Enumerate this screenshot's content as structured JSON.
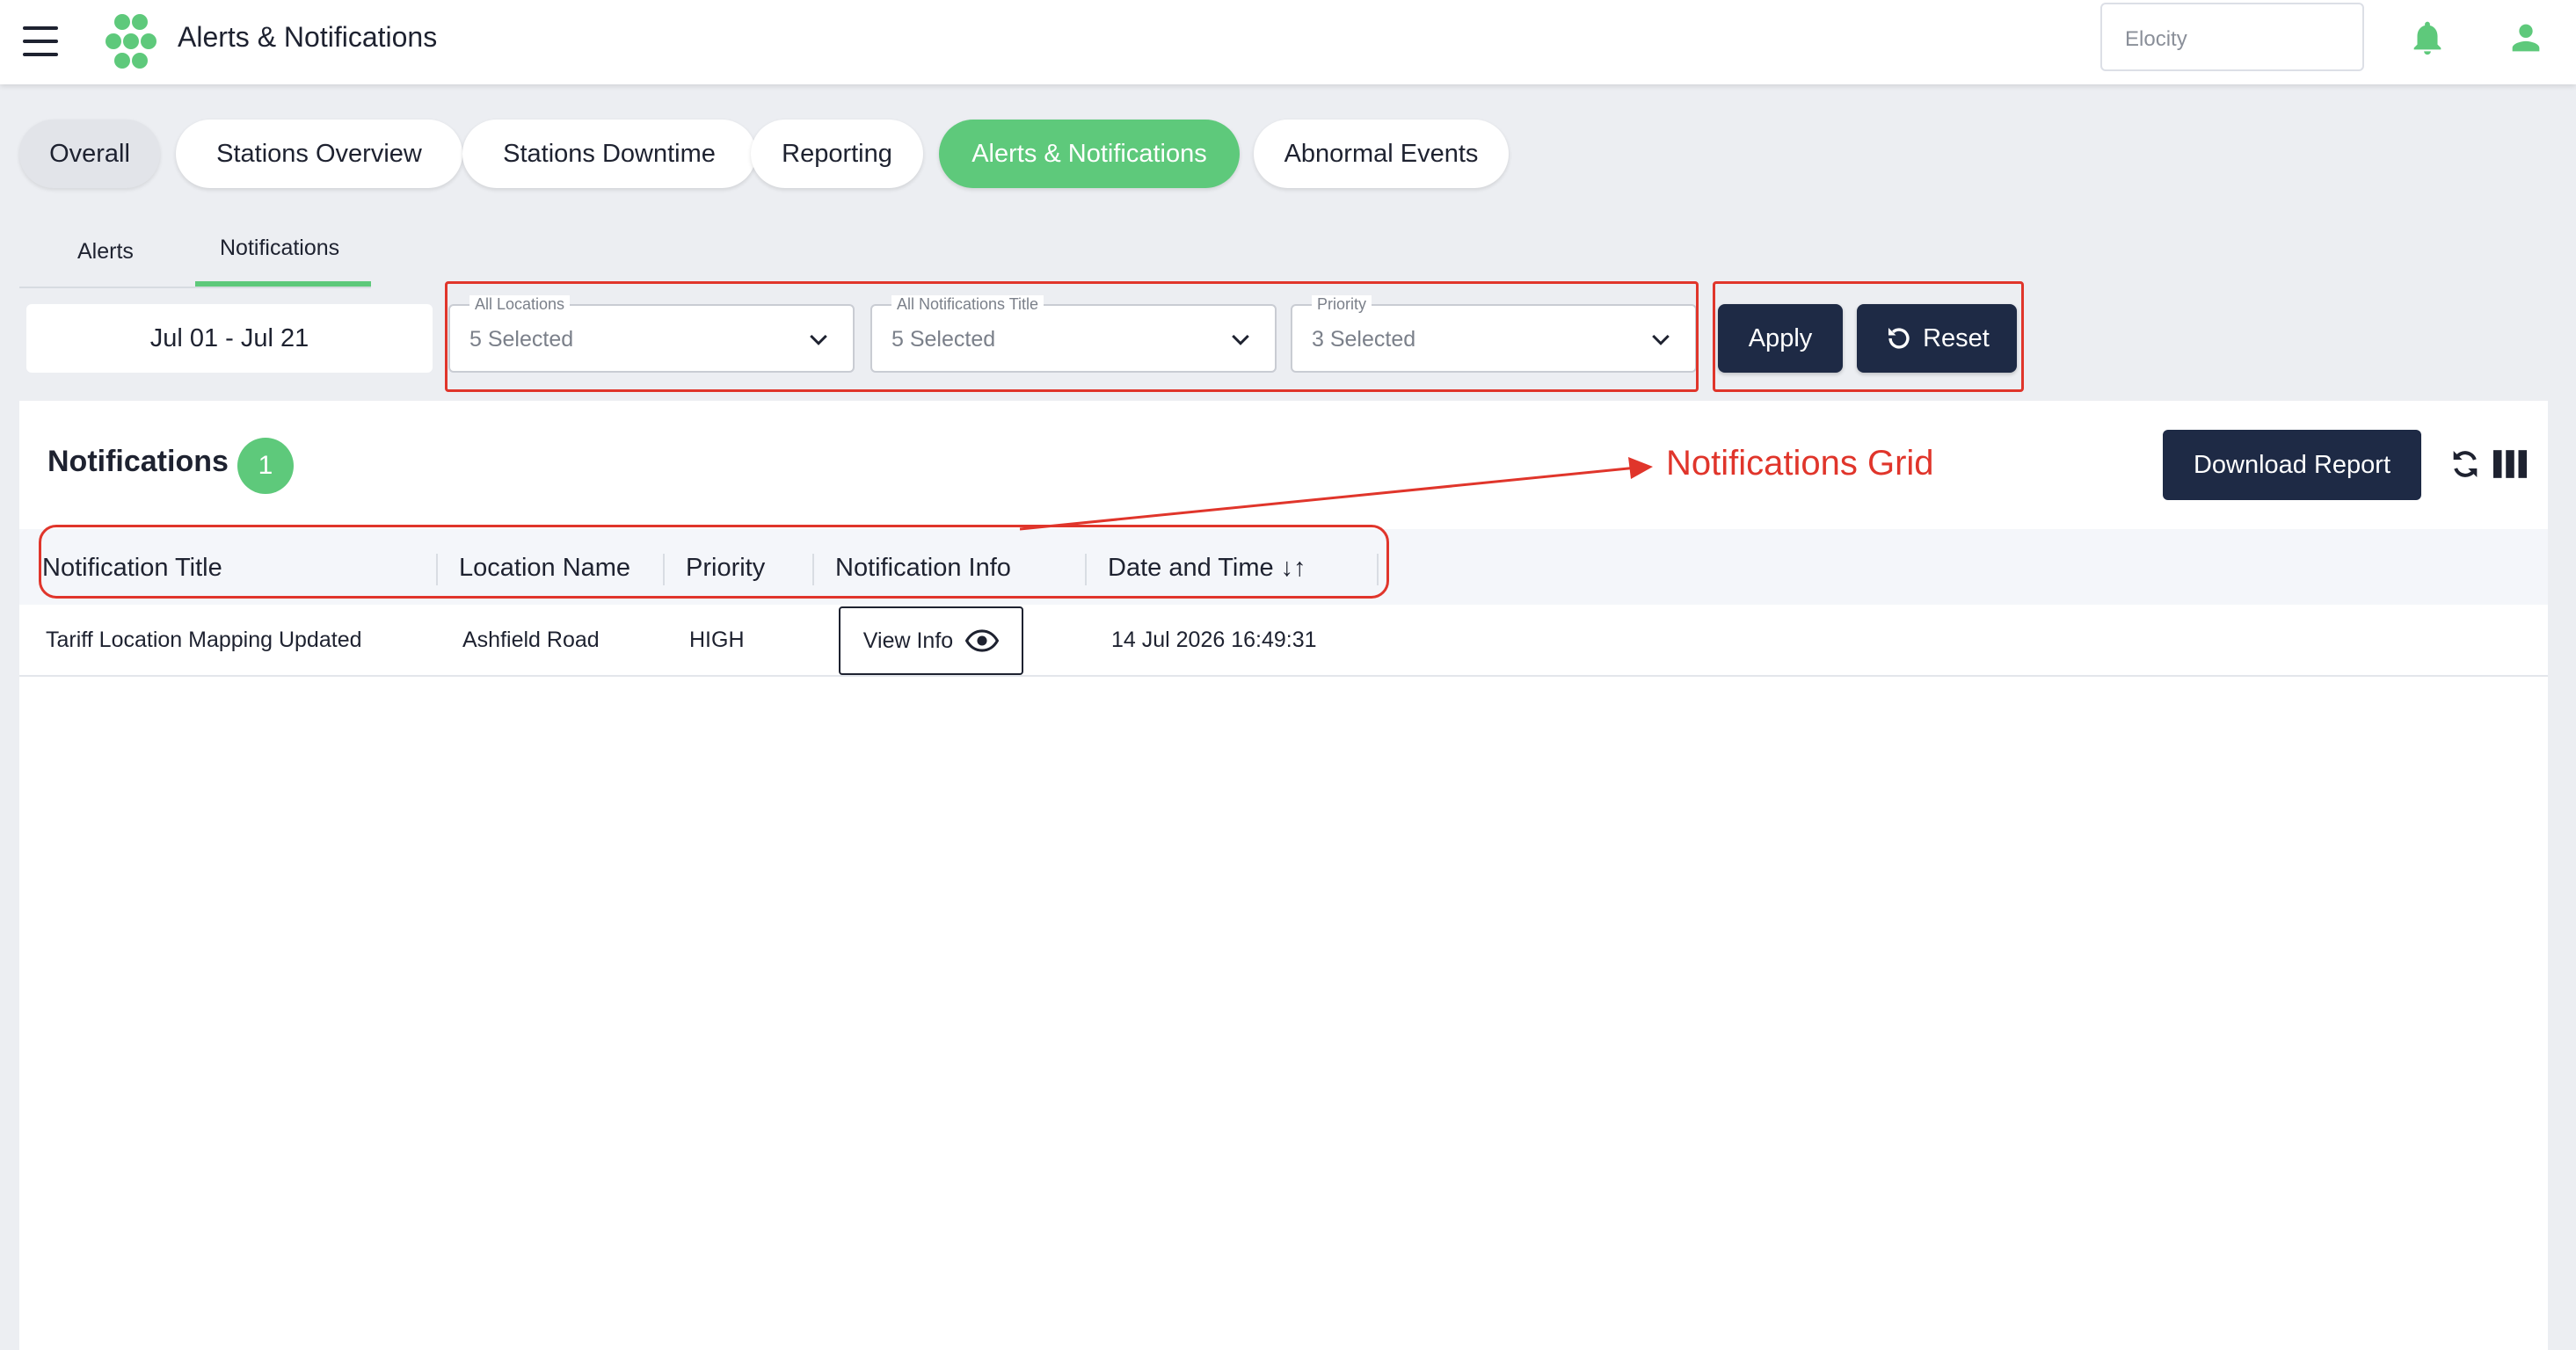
{
  "header": {
    "app_title": "Alerts & Notifications",
    "org_select_value": "Elocity"
  },
  "main_tabs": [
    {
      "label": "Overall",
      "state": "default"
    },
    {
      "label": "Stations Overview",
      "state": "default"
    },
    {
      "label": "Stations Downtime",
      "state": "default"
    },
    {
      "label": "Reporting",
      "state": "default"
    },
    {
      "label": "Alerts & Notifications",
      "state": "active"
    },
    {
      "label": "Abnormal Events",
      "state": "default"
    }
  ],
  "sub_tabs": [
    {
      "label": "Alerts",
      "active": false
    },
    {
      "label": "Notifications",
      "active": true
    }
  ],
  "filters": {
    "date_range": "Jul 01 - Jul 21",
    "locations": {
      "label": "All Locations",
      "value": "5 Selected"
    },
    "titles": {
      "label": "All Notifications Title",
      "value": "5 Selected"
    },
    "priority": {
      "label": "Priority",
      "value": "3 Selected"
    },
    "apply_label": "Apply",
    "reset_label": "Reset"
  },
  "grid": {
    "title": "Notifications",
    "count": "1",
    "download_label": "Download Report",
    "columns": [
      "Notification Title",
      "Location Name",
      "Priority",
      "Notification Info",
      "Date and Time ↓↑"
    ],
    "rows": [
      {
        "title": "Tariff Location Mapping Updated",
        "location": "Ashfield Road",
        "priority": "HIGH",
        "info_button": "View Info",
        "datetime": "14 Jul 2026 16:49:31"
      }
    ]
  },
  "annotation": {
    "label": "Notifications Grid"
  },
  "colors": {
    "accent_green": "#5ec97b",
    "dark_button": "#1e2a45",
    "annotation_red": "#e0352b",
    "background": "#eceef2"
  }
}
